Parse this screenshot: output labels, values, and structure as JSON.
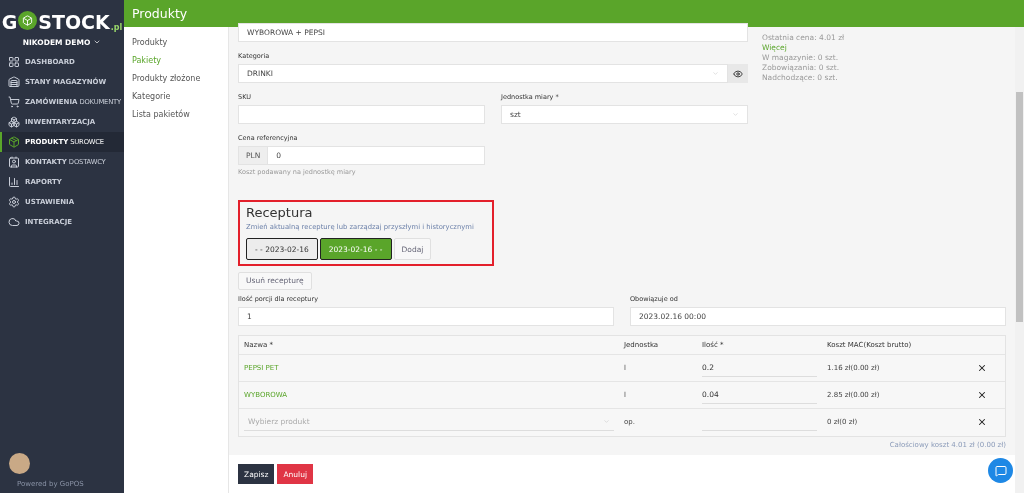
{
  "logo": {
    "first": "G",
    "rest": "STOCK",
    "suffix": ".pl"
  },
  "user": {
    "name": "NIKODEM DEMO"
  },
  "sidebar": {
    "items": [
      {
        "label": "DASHBOARD",
        "selected": false
      },
      {
        "label": "STANY MAGAZYNÓW",
        "selected": false
      },
      {
        "label": "ZAMÓWIENIA",
        "sub": "DOKUMENTY",
        "selected": false
      },
      {
        "label": "INWENTARYZACJA",
        "selected": false
      },
      {
        "label": "PRODUKTY",
        "sub": "SUROWCE",
        "selected": true
      },
      {
        "label": "KONTAKTY",
        "sub": "DOSTAWCY",
        "selected": false
      },
      {
        "label": "RAPORTY",
        "selected": false
      },
      {
        "label": "USTAWIENIA",
        "selected": false
      },
      {
        "label": "INTEGRACJE",
        "selected": false
      }
    ],
    "footer": "Powered by GoPOS"
  },
  "header": {
    "title": "Produkty"
  },
  "subnav": [
    {
      "label": "Produkty",
      "selected": false
    },
    {
      "label": "Pakiety",
      "selected": true
    },
    {
      "label": "Produkty złożone",
      "selected": false
    },
    {
      "label": "Kategorie",
      "selected": false
    },
    {
      "label": "Lista pakietów",
      "selected": false
    }
  ],
  "form": {
    "name_value": "WYBOROWA + PEPSI",
    "category": {
      "label": "Kategoria",
      "value": "DRINKI"
    },
    "sku": {
      "label": "SKU"
    },
    "unit": {
      "label": "Jednostka miary *",
      "value": "szt"
    },
    "price": {
      "label": "Cena referencyjna",
      "currency": "PLN",
      "value": "0",
      "hint": "Koszt podawany na jednostkę miary"
    }
  },
  "info": {
    "last_price": "Ostatnia cena: 4.01 zł",
    "more": "Więcej",
    "stats": [
      "W magazynie: 0 szt.",
      "Zobowiązania: 0 szt.",
      "Nadchodzące: 0 szt."
    ]
  },
  "recipe": {
    "title": "Receptura",
    "subtitle": "Zmień aktualną recepturę lub zarządzaj przyszłymi i historycznymi",
    "versions": [
      {
        "label": "- - 2023-02-16",
        "selected": false
      },
      {
        "label": "2023-02-16 - -",
        "selected": true
      }
    ],
    "add": "Dodaj",
    "remove": "Usuń recepturę",
    "portions": {
      "label": "Ilość porcji dla receptury",
      "value": "1"
    },
    "valid_from": {
      "label": "Obowiązuje od",
      "value": "2023.02.16 00:00"
    },
    "table": {
      "columns": [
        "Nazwa *",
        "Jednostka",
        "Ilość *",
        "Koszt MAC(Koszt brutto)"
      ],
      "rows": [
        {
          "kind": "product",
          "name": "PEPSI PET",
          "unit": "l",
          "qty": "0.2",
          "cost": "1.16 zł(0.00 zł)"
        },
        {
          "kind": "product",
          "name": "WYBOROWA",
          "unit": "l",
          "qty": "0.04",
          "cost": "2.85 zł(0.00 zł)"
        },
        {
          "kind": "picker",
          "placeholder": "Wybierz produkt",
          "unit": "op.",
          "cost": "0 zł(0 zł)"
        }
      ]
    },
    "total": "Całościowy koszt 4.01 zł  (0.00 zł)"
  },
  "actions": {
    "save": "Zapisz",
    "cancel": "Anuluj"
  }
}
